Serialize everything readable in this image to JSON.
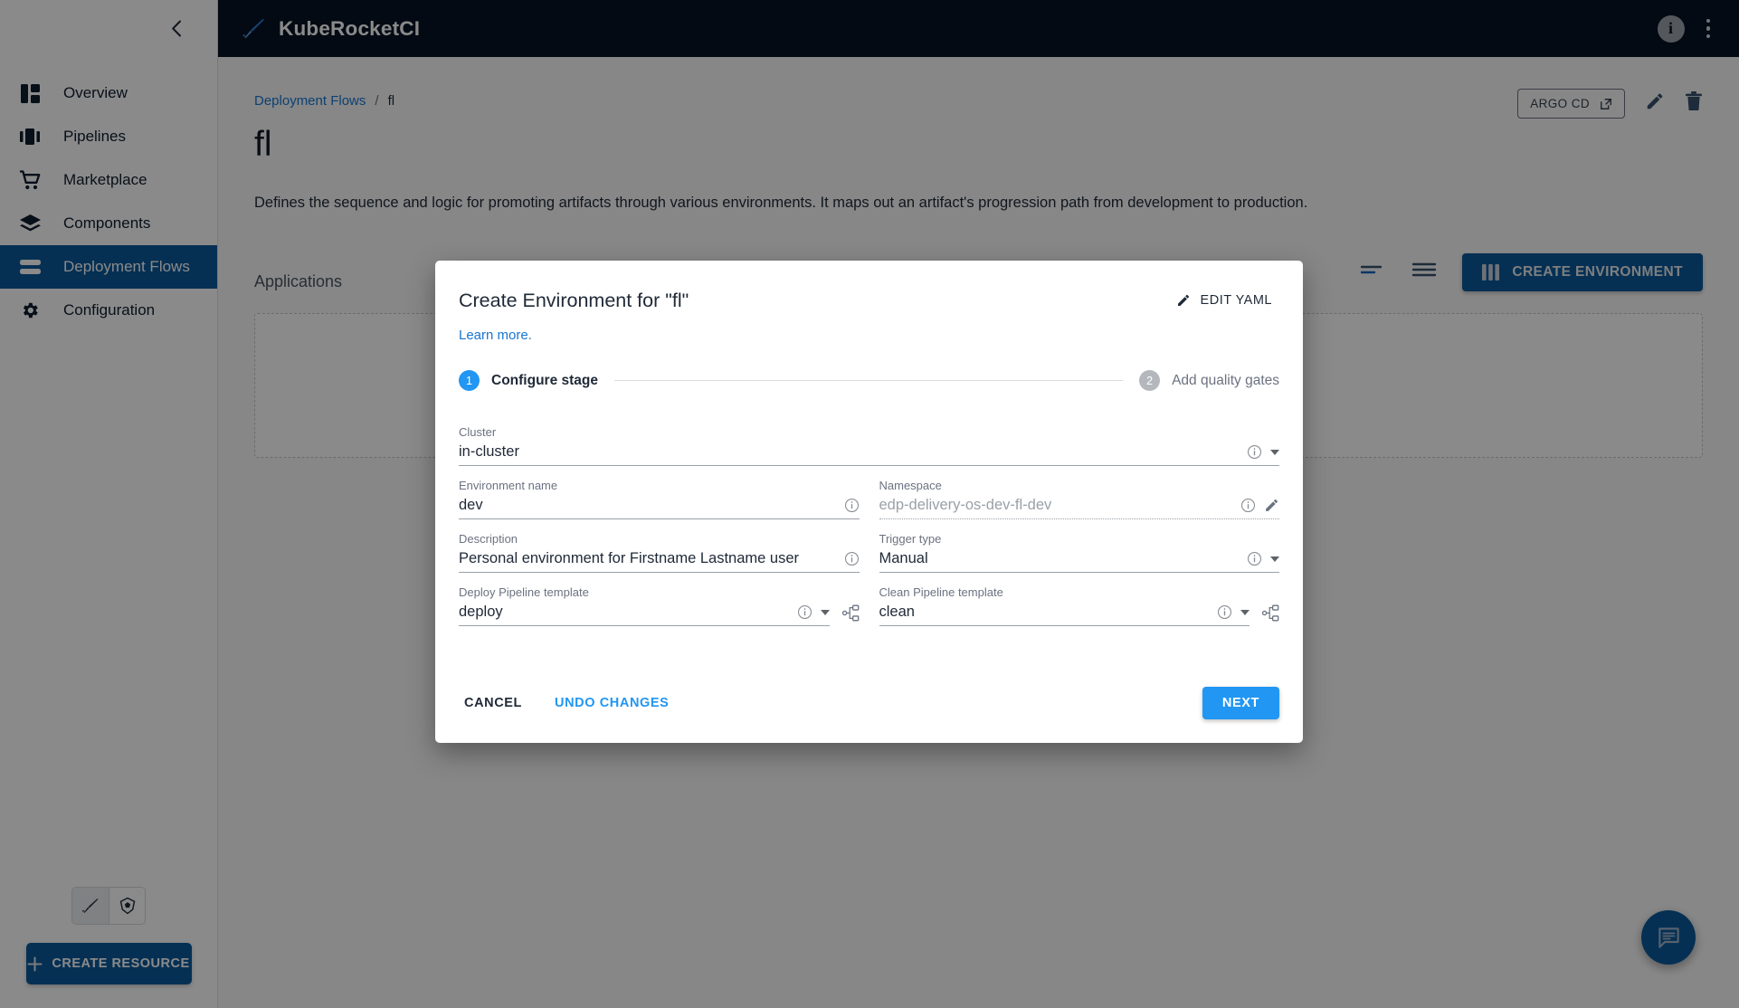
{
  "app": {
    "brand_name": "KubeRocketCI",
    "logo_icon": "rocket-sword-icon",
    "info_icon": "info-icon",
    "kebab_icon": "more-vertical-icon",
    "collapse_icon": "chevron-left-icon"
  },
  "sidebar": {
    "items": [
      {
        "label": "Overview",
        "icon": "dashboard-icon",
        "active": false
      },
      {
        "label": "Pipelines",
        "icon": "pipelines-icon",
        "active": false
      },
      {
        "label": "Marketplace",
        "icon": "shopping-cart-icon",
        "active": false
      },
      {
        "label": "Components",
        "icon": "layers-icon",
        "active": false
      },
      {
        "label": "Deployment Flows",
        "icon": "deployment-flows-icon",
        "active": true
      },
      {
        "label": "Configuration",
        "icon": "gear-icon",
        "active": false
      }
    ],
    "tools": {
      "krci_icon": "rocket-sword-icon",
      "kubernetes_icon": "kubernetes-icon",
      "selected": "krci"
    },
    "create_resource_label": "CREATE RESOURCE",
    "create_resource_icon": "plus-icon"
  },
  "breadcrumb": {
    "parent": "Deployment Flows",
    "separator": "/",
    "current": "fl"
  },
  "page": {
    "title": "fl",
    "description": "Defines the sequence and logic for promoting artifacts through various environments. It maps out an artifact's progression path from development to production.",
    "argo_label": "ARGO CD",
    "argo_icon": "external-link-icon",
    "edit_icon": "pencil-icon",
    "delete_icon": "trash-icon"
  },
  "applications": {
    "label": "Applications",
    "filter_icon": "filter-icon",
    "sort_icon": "sort-icon",
    "create_env_label": "CREATE ENVIRONMENT",
    "create_env_icon": "columns-icon"
  },
  "modal": {
    "title": "Create Environment for \"fl\"",
    "edit_yaml_label": "EDIT YAML",
    "edit_yaml_icon": "pencil-icon",
    "learn_more": "Learn more.",
    "stepper": [
      {
        "num": "1",
        "label": "Configure stage",
        "state": "active"
      },
      {
        "num": "2",
        "label": "Add quality gates",
        "state": "inactive"
      }
    ],
    "fields": {
      "cluster": {
        "label": "Cluster",
        "value": "in-cluster",
        "info_icon": "info-outline-icon",
        "dropdown_icon": "chevron-down-icon"
      },
      "environment_name": {
        "label": "Environment name",
        "value": "dev",
        "info_icon": "info-outline-icon"
      },
      "namespace": {
        "label": "Namespace",
        "placeholder": "edp-delivery-os-dev-fl-dev",
        "value": "",
        "info_icon": "info-outline-icon",
        "edit_icon": "pencil-icon"
      },
      "description": {
        "label": "Description",
        "value": "Personal environment for Firstname Lastname user",
        "info_icon": "info-outline-icon"
      },
      "trigger_type": {
        "label": "Trigger type",
        "value": "Manual",
        "info_icon": "info-outline-icon",
        "dropdown_icon": "chevron-down-icon"
      },
      "deploy_pipeline_template": {
        "label": "Deploy Pipeline template",
        "value": "deploy",
        "info_icon": "info-outline-icon",
        "dropdown_icon": "chevron-down-icon",
        "graph_icon": "pipeline-graph-icon"
      },
      "clean_pipeline_template": {
        "label": "Clean Pipeline template",
        "value": "clean",
        "info_icon": "info-outline-icon",
        "dropdown_icon": "chevron-down-icon",
        "graph_icon": "pipeline-graph-icon"
      }
    },
    "actions": {
      "cancel": "CANCEL",
      "undo": "UNDO CHANGES",
      "next": "NEXT"
    }
  },
  "fab": {
    "icon": "chat-bubble-icon"
  },
  "colors": {
    "brand_dark": "#071426",
    "accent": "#0a5a9c",
    "primary_blue": "#2196f3",
    "link_blue": "#1976d2"
  }
}
